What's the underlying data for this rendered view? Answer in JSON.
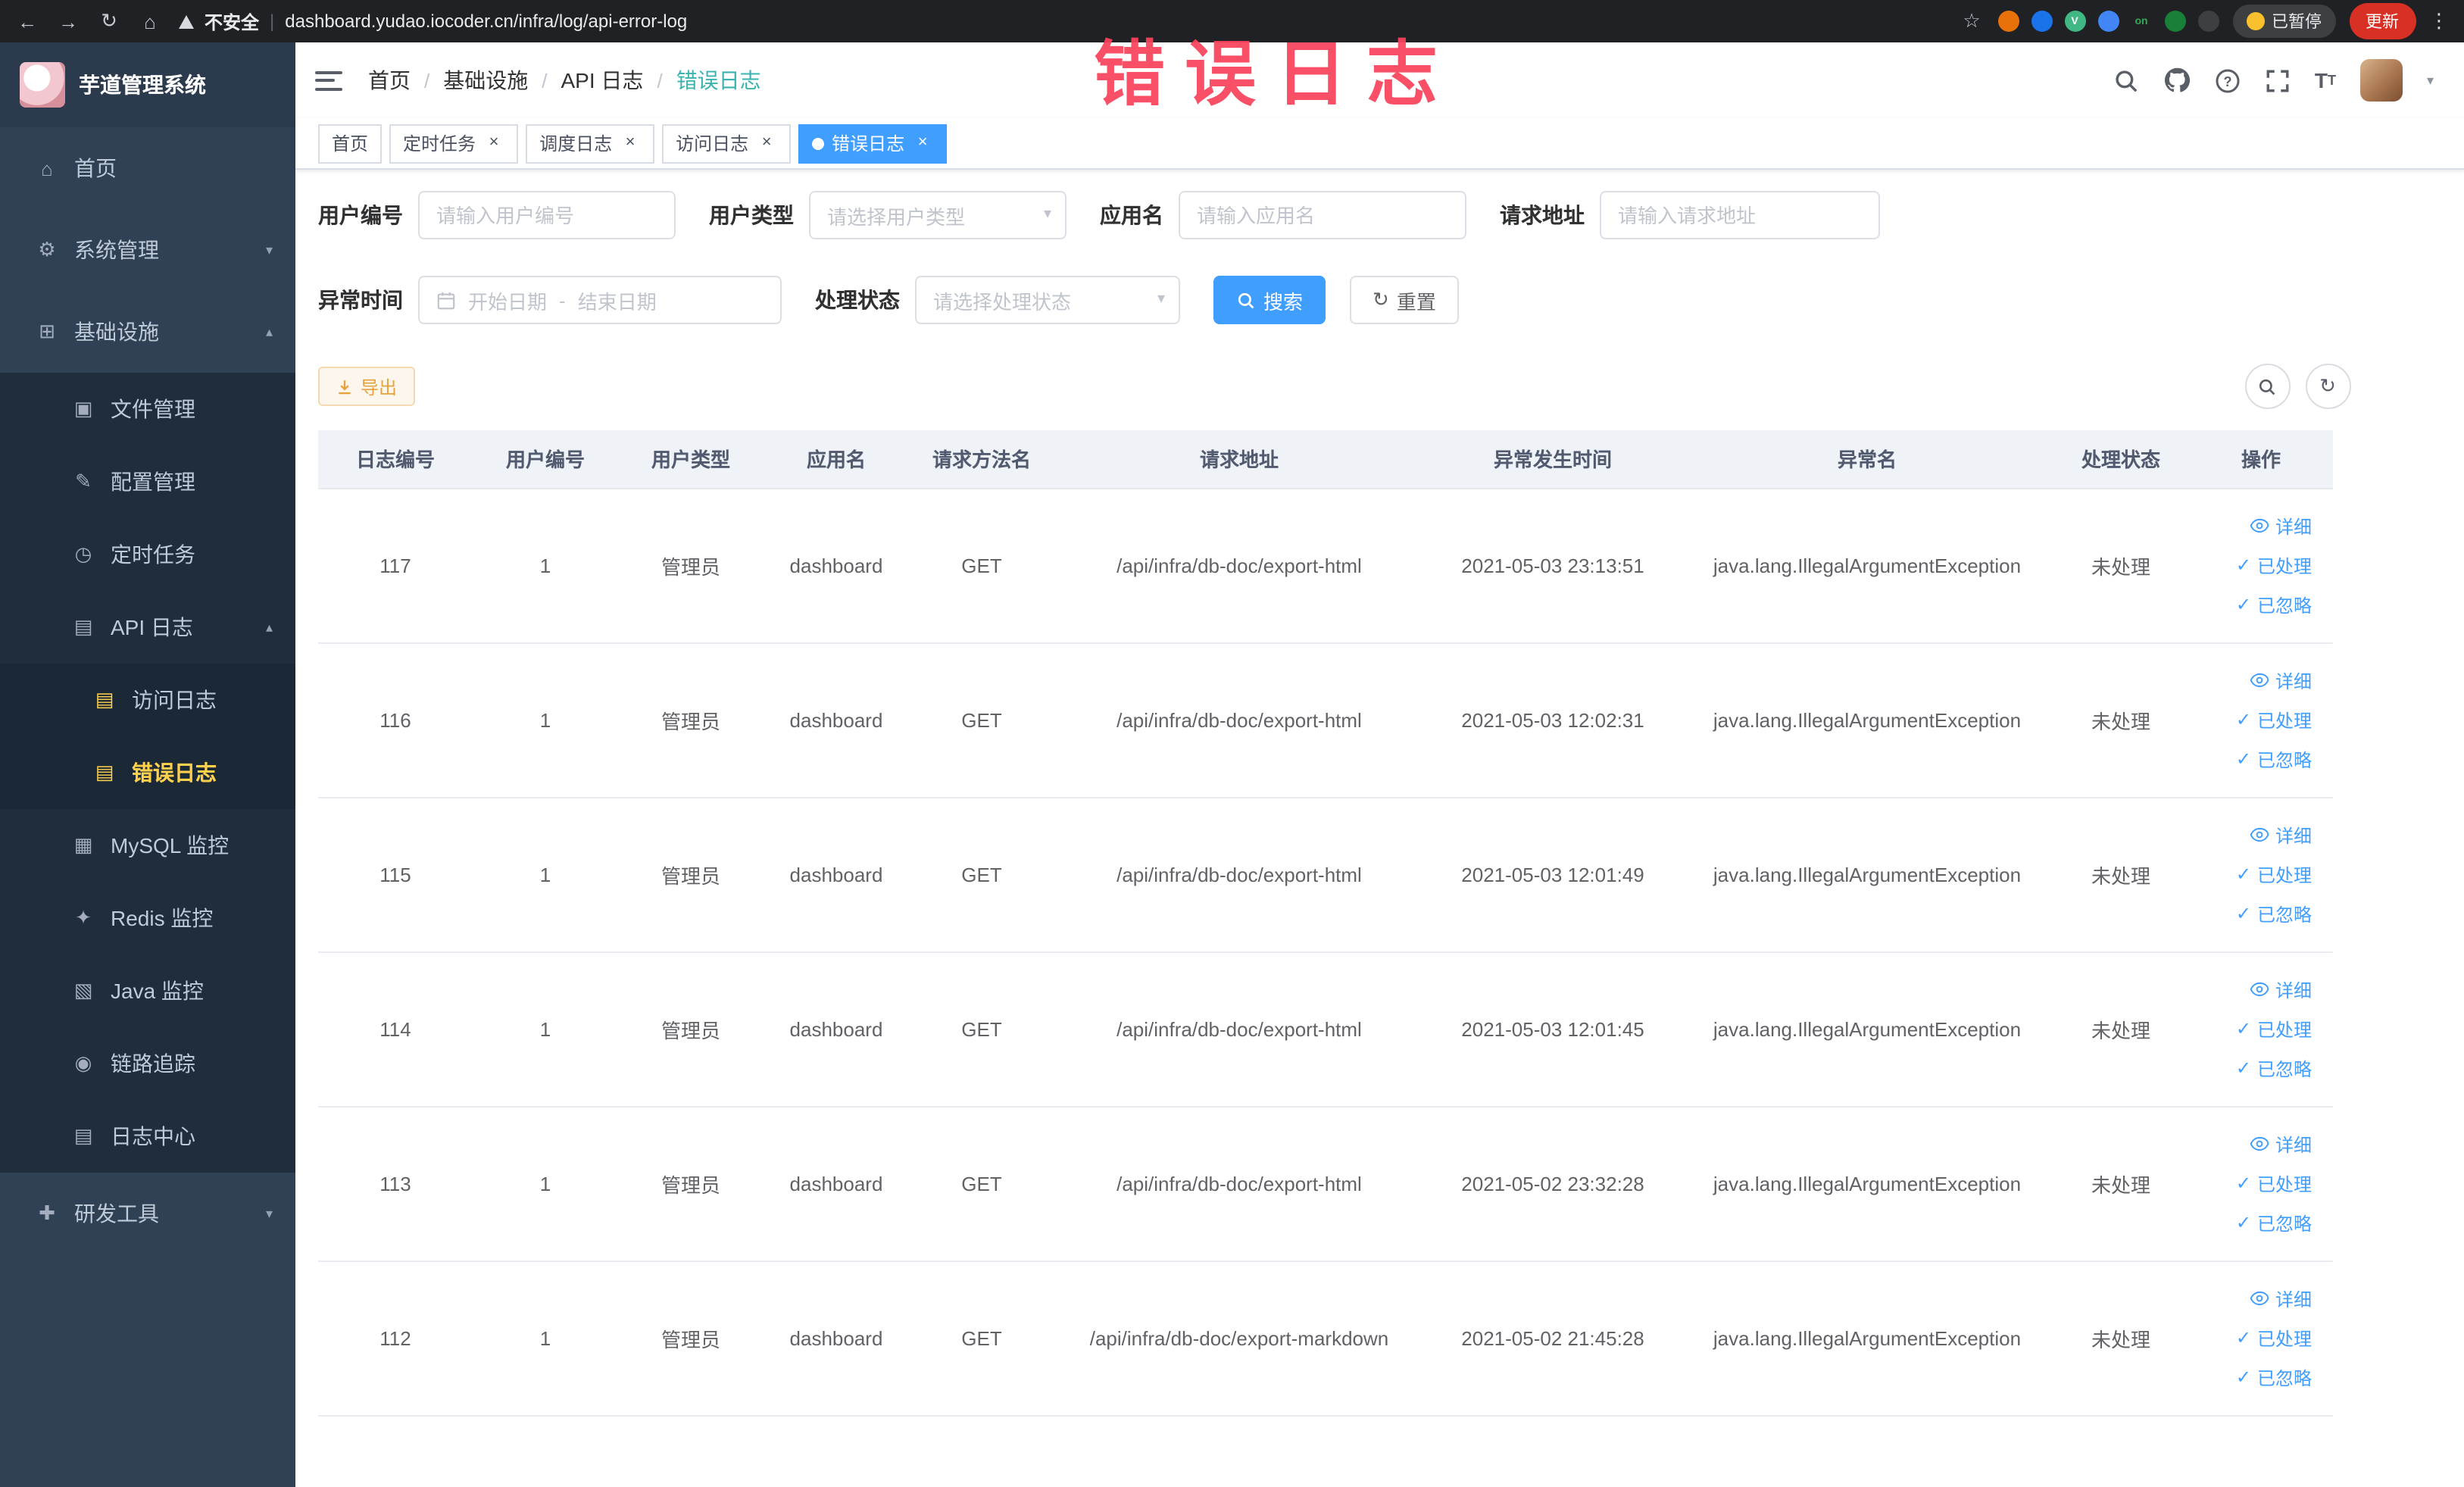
{
  "watermark": "错误日志",
  "browser": {
    "security_label": "不安全",
    "url": "dashboard.yudao.iocoder.cn/infra/log/api-error-log",
    "paused_badge": "已暂停",
    "update_button": "更新",
    "extensions": [
      {
        "name": "extension-icon-1",
        "color": "#e8710a",
        "glyph": ""
      },
      {
        "name": "extension-icon-2",
        "color": "#1a73e8",
        "glyph": ""
      },
      {
        "name": "extension-icon-3",
        "color": "#41b883",
        "glyph": "V"
      },
      {
        "name": "extension-icon-4",
        "color": "#4285f4",
        "glyph": ""
      },
      {
        "name": "extension-icon-5",
        "color": "#202124",
        "glyph": "on"
      },
      {
        "name": "extension-icon-6",
        "color": "#188038",
        "glyph": ""
      },
      {
        "name": "extension-icon-7",
        "color": "#3c4043",
        "glyph": ""
      }
    ]
  },
  "sidebar": {
    "title": "芋道管理系统",
    "items": [
      {
        "label": "首页",
        "icon": "home-icon",
        "level": 1
      },
      {
        "label": "系统管理",
        "icon": "gear-icon",
        "level": 1,
        "arrow": "down"
      },
      {
        "label": "基础设施",
        "icon": "infra-icon",
        "level": 1,
        "arrow": "up"
      },
      {
        "label": "文件管理",
        "icon": "file-icon",
        "level": 2
      },
      {
        "label": "配置管理",
        "icon": "config-icon",
        "level": 2
      },
      {
        "label": "定时任务",
        "icon": "timer-icon",
        "level": 2
      },
      {
        "label": "API 日志",
        "icon": "api-log-icon",
        "level": 2,
        "arrow": "up"
      },
      {
        "label": "访问日志",
        "icon": "access-log-icon",
        "level": 3,
        "highlight": true
      },
      {
        "label": "错误日志",
        "icon": "error-log-icon",
        "level": 3,
        "highlight": true,
        "active": true
      },
      {
        "label": "MySQL 监控",
        "icon": "mysql-icon",
        "level": 2
      },
      {
        "label": "Redis 监控",
        "icon": "redis-icon",
        "level": 2
      },
      {
        "label": "Java 监控",
        "icon": "java-icon",
        "level": 2
      },
      {
        "label": "链路追踪",
        "icon": "trace-icon",
        "level": 2
      },
      {
        "label": "日志中心",
        "icon": "log-center-icon",
        "level": 2
      },
      {
        "label": "研发工具",
        "icon": "devtools-icon",
        "level": 1,
        "arrow": "down"
      }
    ]
  },
  "navbar": {
    "breadcrumb": [
      "首页",
      "基础设施",
      "API 日志",
      "错误日志"
    ],
    "separator": "/"
  },
  "tabs": [
    {
      "label": "首页",
      "closable": false,
      "active": false
    },
    {
      "label": "定时任务",
      "closable": true,
      "active": false
    },
    {
      "label": "调度日志",
      "closable": true,
      "active": false
    },
    {
      "label": "访问日志",
      "closable": true,
      "active": false
    },
    {
      "label": "错误日志",
      "closable": true,
      "active": true
    }
  ],
  "filters": {
    "user_id": {
      "label": "用户编号",
      "placeholder": "请输入用户编号"
    },
    "user_type": {
      "label": "用户类型",
      "placeholder": "请选择用户类型"
    },
    "app_name": {
      "label": "应用名",
      "placeholder": "请输入应用名"
    },
    "request_url": {
      "label": "请求地址",
      "placeholder": "请输入请求地址"
    },
    "exception_time": {
      "label": "异常时间",
      "start_placeholder": "开始日期",
      "separator": "-",
      "end_placeholder": "结束日期"
    },
    "process_status": {
      "label": "处理状态",
      "placeholder": "请选择处理状态"
    },
    "search_button": "搜索",
    "reset_button": "重置"
  },
  "toolbar": {
    "export_button": "导出"
  },
  "table": {
    "columns": [
      "日志编号",
      "用户编号",
      "用户类型",
      "应用名",
      "请求方法名",
      "请求地址",
      "异常发生时间",
      "异常名",
      "处理状态",
      "操作"
    ],
    "actions": [
      "详细",
      "已处理",
      "已忽略"
    ],
    "rows": [
      {
        "log_id": "117",
        "user_id": "1",
        "user_type": "管理员",
        "app_name": "dashboard",
        "method": "GET",
        "url": "/api/infra/db-doc/export-html",
        "time": "2021-05-03 23:13:51",
        "exception": "java.lang.IllegalArgumentException",
        "status": "未处理"
      },
      {
        "log_id": "116",
        "user_id": "1",
        "user_type": "管理员",
        "app_name": "dashboard",
        "method": "GET",
        "url": "/api/infra/db-doc/export-html",
        "time": "2021-05-03 12:02:31",
        "exception": "java.lang.IllegalArgumentException",
        "status": "未处理"
      },
      {
        "log_id": "115",
        "user_id": "1",
        "user_type": "管理员",
        "app_name": "dashboard",
        "method": "GET",
        "url": "/api/infra/db-doc/export-html",
        "time": "2021-05-03 12:01:49",
        "exception": "java.lang.IllegalArgumentException",
        "status": "未处理"
      },
      {
        "log_id": "114",
        "user_id": "1",
        "user_type": "管理员",
        "app_name": "dashboard",
        "method": "GET",
        "url": "/api/infra/db-doc/export-html",
        "time": "2021-05-03 12:01:45",
        "exception": "java.lang.IllegalArgumentException",
        "status": "未处理"
      },
      {
        "log_id": "113",
        "user_id": "1",
        "user_type": "管理员",
        "app_name": "dashboard",
        "method": "GET",
        "url": "/api/infra/db-doc/export-html",
        "time": "2021-05-02 23:32:28",
        "exception": "java.lang.IllegalArgumentException",
        "status": "未处理"
      },
      {
        "log_id": "112",
        "user_id": "1",
        "user_type": "管理员",
        "app_name": "dashboard",
        "method": "GET",
        "url": "/api/infra/db-doc/export-markdown",
        "time": "2021-05-02 21:45:28",
        "exception": "java.lang.IllegalArgumentException",
        "status": "未处理"
      }
    ]
  },
  "colors": {
    "primary": "#409eff",
    "warning": "#e6a23c",
    "sidebar_bg": "#304156",
    "sidebar_submenu_bg": "#1f2d3d",
    "sidebar_active_text": "#ffd04b",
    "breadcrumb_active": "#3ab3b0",
    "watermark_red": "#fa435c"
  }
}
